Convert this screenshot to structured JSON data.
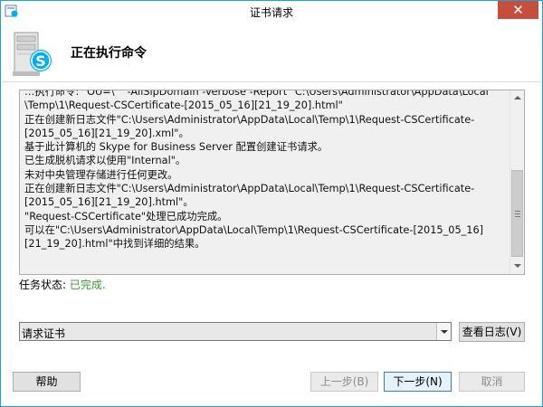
{
  "window": {
    "title": "证书请求",
    "close_glyph": "✕"
  },
  "header": {
    "title": "正在执行命令",
    "icon": "skype-server-icon"
  },
  "log": {
    "lines": [
      "…执行命令: \"OU=\\\"\" -AllSipDomain -Verbose -Report \"C:\\Users\\Administrator\\AppData\\Local",
      "\\Temp\\1\\Request-CSCertificate-[2015_05_16][21_19_20].html\"",
      "正在创建新日志文件\"C:\\Users\\Administrator\\AppData\\Local\\Temp\\1\\Request-CSCertificate-",
      "[2015_05_16][21_19_20].xml\"。",
      "基于此计算机的 Skype for Business Server 配置创建证书请求。",
      "已生成脱机请求以使用\"Internal\"。",
      "未对中央管理存储进行任何更改。",
      "正在创建新日志文件\"C:\\Users\\Administrator\\AppData\\Local\\Temp\\1\\Request-CSCertificate-",
      "[2015_05_16][21_19_20].html\"。",
      "\"Request-CSCertificate\"处理已成功完成。",
      "可以在\"C:\\Users\\Administrator\\AppData\\Local\\Temp\\1\\Request-CSCertificate-[2015_05_16]",
      "[21_19_20].html\"中找到详细的结果。"
    ]
  },
  "status": {
    "label": "任务状态:",
    "value": "已完成."
  },
  "task_select": {
    "value": "请求证书"
  },
  "buttons": {
    "view_log": "查看日志(V)",
    "help": "帮助",
    "prev": "上一步(B)",
    "next": "下一步(N)",
    "cancel": "取消"
  },
  "colors": {
    "window_border": "#1ba1e2",
    "close_button": "#c74e3d",
    "status_success": "#3a9a3a",
    "skype_blue": "#00aff0"
  }
}
